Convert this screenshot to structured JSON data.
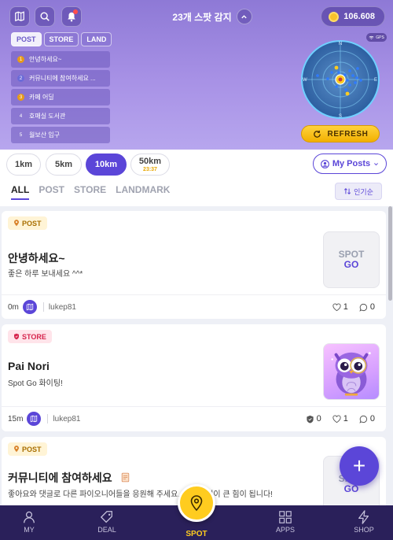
{
  "header": {
    "detect_text": "23개 스팟 감지",
    "coins": "106.608",
    "segments": [
      "POST",
      "STORE",
      "LAND"
    ],
    "spots": [
      {
        "num": "1",
        "label": "안녕하세요~",
        "color": "#e69a1a"
      },
      {
        "num": "2",
        "label": "커뮤니티에 참여하세요 ...",
        "color": "#6b6bd8"
      },
      {
        "num": "3",
        "label": "카페 어딜",
        "color": "#e69a1a"
      },
      {
        "num": "4",
        "label": "호매실 도서관",
        "color": ""
      },
      {
        "num": "5",
        "label": "월보산 입구",
        "color": ""
      }
    ],
    "radar_labels": {
      "n": "N",
      "s": "S",
      "w": "W",
      "e": "E"
    },
    "gps": "GPS",
    "refresh": "REFRESH"
  },
  "filters": {
    "distances": [
      "1km",
      "5km",
      "10km",
      "50km"
    ],
    "timer": "23:37",
    "active_distance": "10km",
    "my_posts": "My Posts",
    "tabs": [
      "ALL",
      "POST",
      "STORE",
      "LANDMARK"
    ],
    "sort": "인기순"
  },
  "feed": [
    {
      "tag": "POST",
      "title": "안녕하세요~",
      "desc": "좋은 하루 보내세요 ^^*",
      "thumb": [
        "SPOT",
        "GO"
      ],
      "distance": "0m",
      "user": "lukep81",
      "likes": "1",
      "comments": "0"
    },
    {
      "tag": "STORE",
      "title": "Pai Nori",
      "desc": "Spot Go 화이팅!",
      "distance": "15m",
      "user": "lukep81",
      "shields": "0",
      "likes": "1",
      "comments": "0"
    },
    {
      "tag": "POST",
      "title": "커뮤니티에 참여하세요",
      "desc": "좋아요와 댓글로 다른 파이오니어들을 응원해 주세요. 작은 관심이 큰 힘이 됩니다!",
      "thumb": [
        "SPOT",
        "GO"
      ]
    }
  ],
  "fab": "+",
  "nav": [
    "MY",
    "DEAL",
    "SPOT",
    "APPS",
    "SHOP"
  ],
  "colors": {
    "accent": "#5b46d8",
    "gold": "#ffcc1f",
    "nav_bg": "#2a205a"
  }
}
